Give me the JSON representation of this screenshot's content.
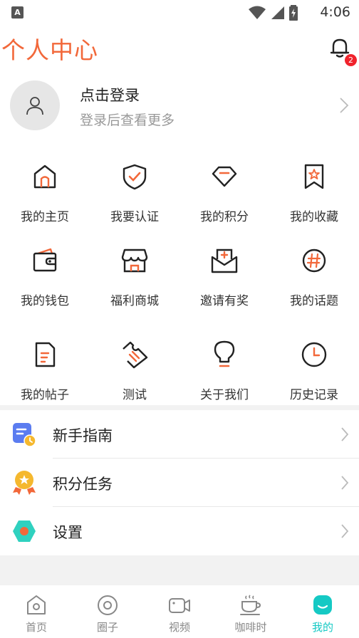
{
  "status_bar": {
    "app_badge": "A",
    "time": "4:06"
  },
  "header": {
    "title": "个人中心",
    "notification_count": "2"
  },
  "login": {
    "title": "点击登录",
    "subtitle": "登录后查看更多"
  },
  "grid": [
    {
      "label": "我的主页",
      "icon": "home-icon"
    },
    {
      "label": "我要认证",
      "icon": "shield-check-icon"
    },
    {
      "label": "我的积分",
      "icon": "diamond-icon"
    },
    {
      "label": "我的收藏",
      "icon": "bookmark-star-icon"
    },
    {
      "label": "我的钱包",
      "icon": "wallet-icon"
    },
    {
      "label": "福利商城",
      "icon": "shop-icon"
    },
    {
      "label": "邀请有奖",
      "icon": "gift-envelope-icon"
    },
    {
      "label": "我的话题",
      "icon": "hashtag-icon"
    },
    {
      "label": "我的帖子",
      "icon": "document-icon"
    },
    {
      "label": "测试",
      "icon": "ticket-icon"
    },
    {
      "label": "关于我们",
      "icon": "lightbulb-icon"
    },
    {
      "label": "历史记录",
      "icon": "clock-icon"
    }
  ],
  "menu": [
    {
      "label": "新手指南",
      "icon": "guide-icon"
    },
    {
      "label": "积分任务",
      "icon": "medal-icon"
    },
    {
      "label": "设置",
      "icon": "settings-hex-icon"
    }
  ],
  "tabs": [
    {
      "label": "首页",
      "icon": "home-tab-icon"
    },
    {
      "label": "圈子",
      "icon": "circle-tab-icon"
    },
    {
      "label": "视频",
      "icon": "video-tab-icon"
    },
    {
      "label": "咖啡时",
      "icon": "coffee-tab-icon"
    },
    {
      "label": "我的",
      "icon": "profile-tab-icon",
      "active": true
    }
  ],
  "colors": {
    "accent": "#f2683a",
    "active_tab": "#15c9c4",
    "badge": "#f0232c",
    "menu_guide": "#5b7cf0",
    "menu_medal": "#f5b82e",
    "menu_settings": "#2fd1bf"
  }
}
